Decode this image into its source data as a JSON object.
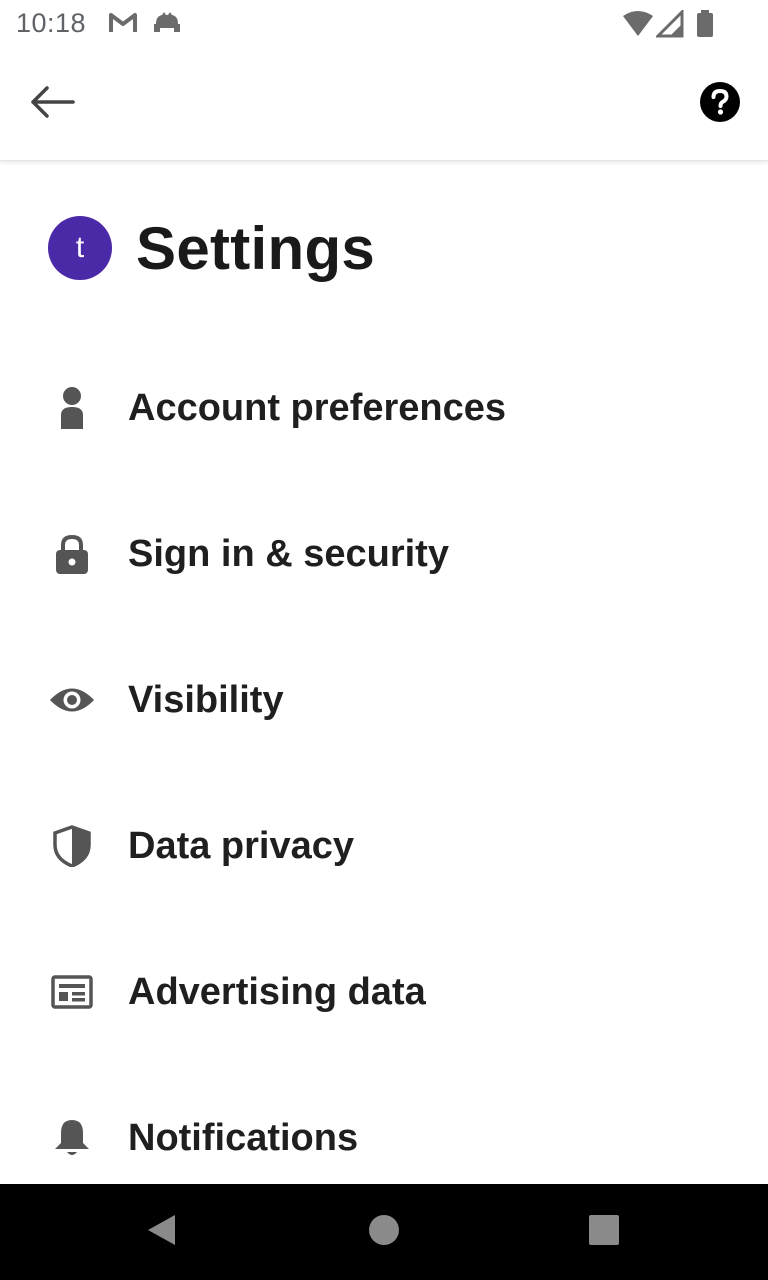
{
  "status_bar": {
    "time": "10:18",
    "left_icons": [
      "gmail-icon",
      "android-debug-icon"
    ],
    "right_icons": [
      "wifi-icon",
      "cell-signal-icon",
      "battery-icon"
    ]
  },
  "app_bar": {
    "back_icon": "arrow-left-icon",
    "help_icon": "help-circle-icon"
  },
  "header": {
    "avatar_letter": "t",
    "avatar_color": "#4b2aa8",
    "title": "Settings"
  },
  "settings": {
    "items": [
      {
        "label": "Account preferences",
        "icon": "person-icon"
      },
      {
        "label": "Sign in & security",
        "icon": "lock-icon"
      },
      {
        "label": "Visibility",
        "icon": "eye-icon"
      },
      {
        "label": "Data privacy",
        "icon": "shield-icon"
      },
      {
        "label": "Advertising data",
        "icon": "ad-card-icon"
      },
      {
        "label": "Notifications",
        "icon": "bell-icon"
      }
    ]
  },
  "nav_bar": {
    "buttons": [
      "back-triangle-icon",
      "home-circle-icon",
      "recents-square-icon"
    ]
  }
}
